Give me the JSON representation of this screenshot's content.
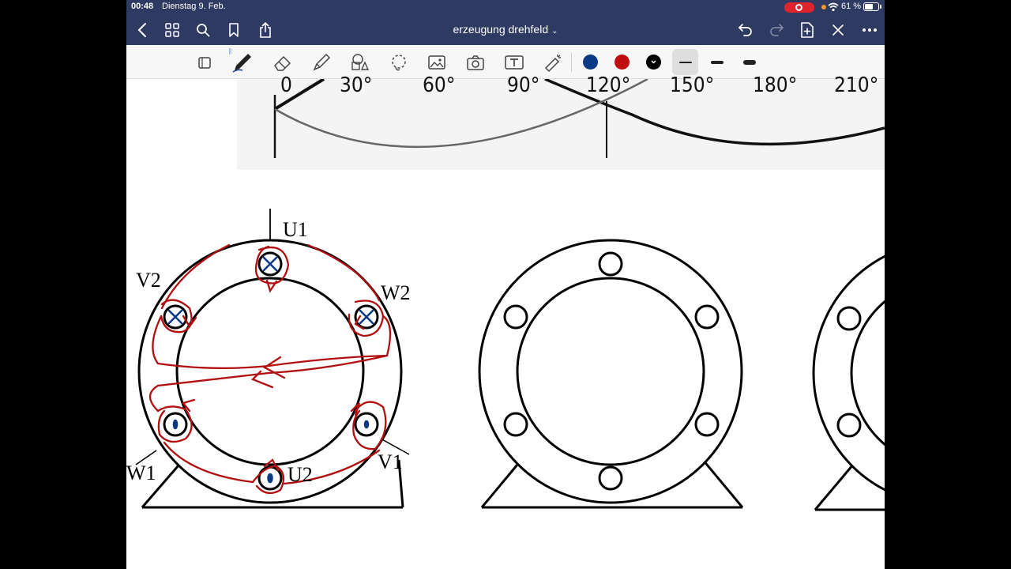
{
  "status_bar": {
    "time": "00:48",
    "date": "Dienstag 9. Feb.",
    "battery": "61 %"
  },
  "nav_bar": {
    "title": "erzeugung drehfeld",
    "title_chevron": "⌄"
  },
  "toolbar": {
    "tools": [
      "shapes-tool-icon",
      "pen-icon",
      "eraser-icon",
      "highlighter-icon",
      "shapes-icon",
      "lasso-icon",
      "image-icon",
      "camera-icon",
      "text-box-icon",
      "laser-pointer-icon"
    ],
    "colors": [
      "#0a3a86",
      "#c00d0d",
      "#000000"
    ],
    "stroke_widths": [
      "thin",
      "medium",
      "thick"
    ]
  },
  "document": {
    "angle_axis_labels": [
      "0",
      "30°",
      "60°",
      "90°",
      "120°",
      "150°",
      "180°",
      "210°"
    ],
    "motor_1_labels": {
      "u1": "U1",
      "v2": "V2",
      "w2": "W2",
      "w1": "W1",
      "u2": "U2",
      "v1": "V1"
    },
    "ink_color": "#b10f10",
    "cross_color": "#0a3a86"
  }
}
